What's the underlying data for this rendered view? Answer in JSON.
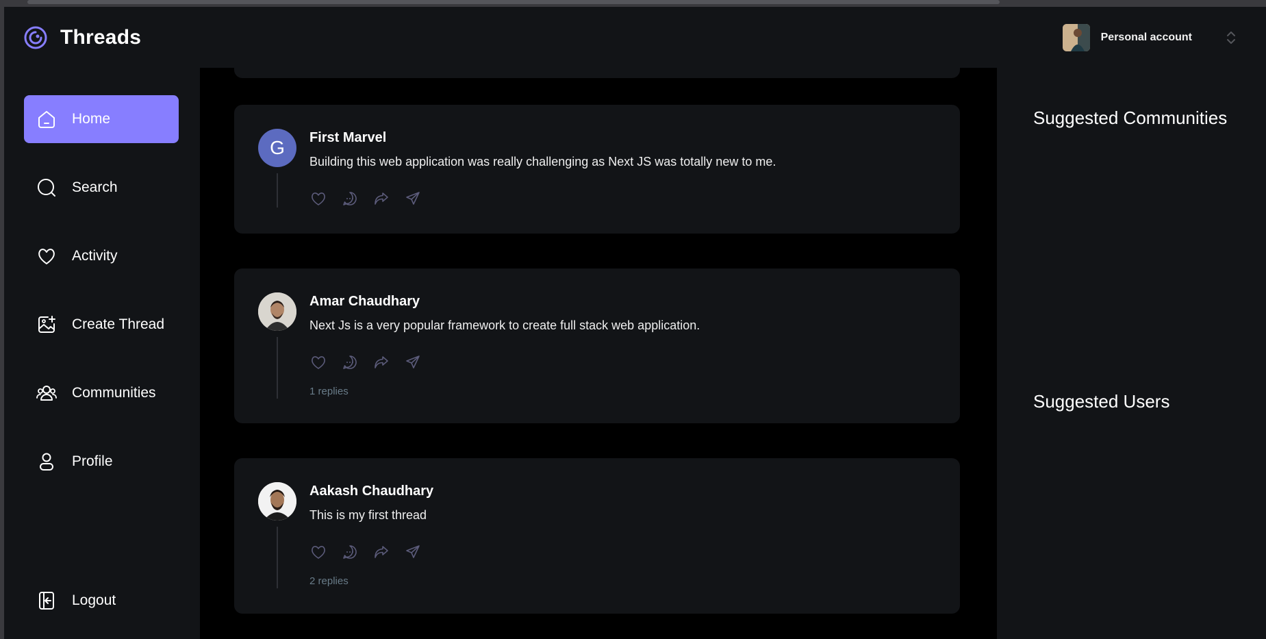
{
  "app": {
    "name": "Threads",
    "accent_color": "#877eff",
    "logo_icon": "threads-logo-icon"
  },
  "account": {
    "label": "Personal account",
    "avatar_icon": "user-photo",
    "switcher_icon": "chevron-up-down-icon"
  },
  "sidebar": {
    "items": [
      {
        "label": "Home",
        "icon": "home-icon",
        "active": true
      },
      {
        "label": "Search",
        "icon": "search-icon",
        "active": false
      },
      {
        "label": "Activity",
        "icon": "heart-icon",
        "active": false
      },
      {
        "label": "Create Thread",
        "icon": "image-plus-icon",
        "active": false
      },
      {
        "label": "Communities",
        "icon": "users-icon",
        "active": false
      },
      {
        "label": "Profile",
        "icon": "user-icon",
        "active": false
      }
    ],
    "logout": {
      "label": "Logout",
      "icon": "logout-icon"
    }
  },
  "feed": {
    "threads": [
      {
        "author": "First Marvel",
        "avatar_letter": "G",
        "content": "Building this web application was really challenging as Next JS was totally new to me.",
        "replies": ""
      },
      {
        "author": "Amar Chaudhary",
        "avatar_letter": "",
        "content": "Next Js is a very popular framework to create full stack web application.",
        "replies": "1 replies"
      },
      {
        "author": "Aakash Chaudhary",
        "avatar_letter": "",
        "content": "This is my first thread",
        "replies": "2 replies"
      }
    ],
    "action_icons": [
      "heart-icon",
      "reply-icon",
      "repost-icon",
      "share-icon"
    ]
  },
  "rightbar": {
    "suggested_communities": "Suggested Communities",
    "suggested_users": "Suggested Users"
  }
}
